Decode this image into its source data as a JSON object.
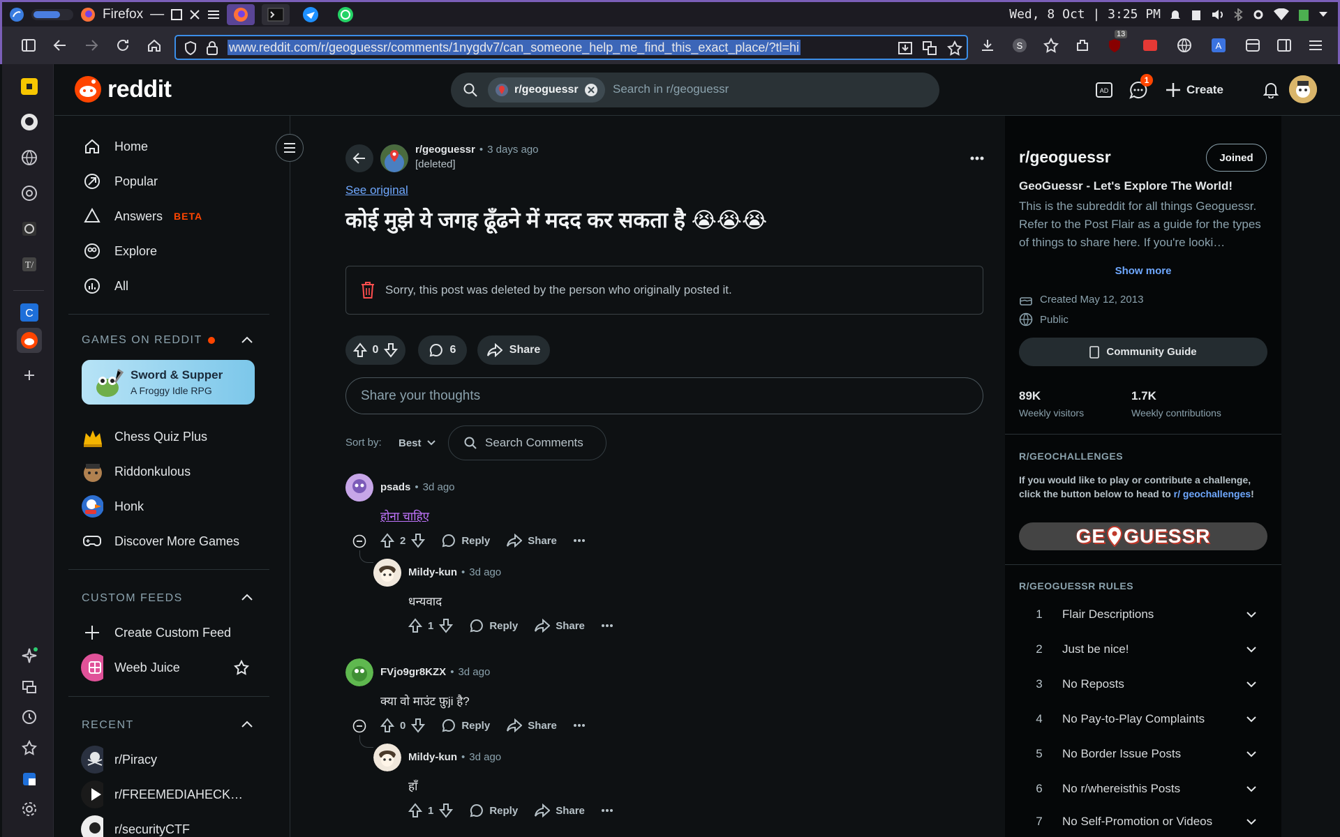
{
  "os_bar": {
    "app_name": "Firefox",
    "datetime": "Wed, 8 Oct | 3:25 PM",
    "colors": {
      "border": "#7b5fb8",
      "active_tab": "#5a4596"
    }
  },
  "browser": {
    "url": "www.reddit.com/r/geoguessr/comments/1nygdv7/can_someone_help_me_find_this_exact_place/?tl=hi",
    "extension_badge": "13"
  },
  "header": {
    "logo_text": "reddit",
    "search_chip": "r/geoguessr",
    "search_placeholder": "Search in r/geoguessr",
    "chat_badge": "1",
    "create_label": "Create"
  },
  "left_nav": {
    "items": [
      {
        "label": "Home",
        "icon": "home-icon"
      },
      {
        "label": "Popular",
        "icon": "popular-icon"
      },
      {
        "label": "Answers",
        "icon": "answers-icon",
        "badge": "BETA"
      },
      {
        "label": "Explore",
        "icon": "explore-icon"
      },
      {
        "label": "All",
        "icon": "all-icon"
      }
    ],
    "games_section": "GAMES ON REDDIT",
    "featured_game": {
      "title": "Sword & Supper",
      "subtitle": "A Froggy Idle RPG"
    },
    "games": [
      "Chess Quiz Plus",
      "Riddonkulous",
      "Honk",
      "Discover More Games"
    ],
    "custom_feeds_section": "CUSTOM FEEDS",
    "custom_feeds": [
      "Create Custom Feed",
      "Weeb Juice"
    ],
    "recent_section": "RECENT",
    "recent": [
      "r/Piracy",
      "r/FREEMEDIAHECK…",
      "r/securityCTF"
    ]
  },
  "post": {
    "subreddit": "r/geoguessr",
    "time": "3 days ago",
    "author": "[deleted]",
    "see_original": "See original",
    "title": "कोई मुझे ये जगह ढूँढने में मदद कर सकता है 😭😭😭",
    "deleted_notice": "Sorry, this post was deleted by the person who originally posted it.",
    "votes": "0",
    "comments": "6",
    "share_label": "Share",
    "comment_placeholder": "Share your thoughts",
    "sort_label": "Sort by:",
    "sort_value": "Best",
    "search_comments": "Search Comments"
  },
  "comments": [
    {
      "author": "psads",
      "time": "3d ago",
      "text": "होना चाहिए",
      "votes": "2"
    },
    {
      "author": "Mildy-kun",
      "time": "3d ago",
      "text": "धन्यवाद",
      "votes": "1"
    },
    {
      "author": "FVjo9gr8KZX",
      "time": "3d ago",
      "text": "क्या वो माउंट फ़ुji है?",
      "votes": "0"
    },
    {
      "author": "Mildy-kun",
      "time": "3d ago",
      "text": "हाँ",
      "votes": "1"
    }
  ],
  "comment_actions": {
    "reply": "Reply",
    "share": "Share",
    "dot": "•"
  },
  "right_sidebar": {
    "name": "r/geoguessr",
    "joined_label": "Joined",
    "tagline": "GeoGuessr - Let's Explore The World!",
    "description": "This is the subreddit for all things Geoguessr. Refer to the Post Flair as a guide for the types of things to share here. If you're looki…",
    "show_more": "Show more",
    "created": "Created May 12, 2013",
    "visibility": "Public",
    "guide_label": "Community Guide",
    "stats": [
      {
        "value": "89K",
        "label": "Weekly visitors"
      },
      {
        "value": "1.7K",
        "label": "Weekly contributions"
      }
    ],
    "challenges_title": "R/GEOCHALLENGES",
    "challenges_text": "If you would like to play or contribute a challenge, click the button below to head to",
    "challenges_link": "r/ geochallenges",
    "challenges_end": "!",
    "banner_text": "GE",
    "banner_text2": "GUESSR",
    "rules_title": "R/GEOGUESSR RULES",
    "rules": [
      {
        "n": "1",
        "t": "Flair Descriptions"
      },
      {
        "n": "2",
        "t": "Just be nice!"
      },
      {
        "n": "3",
        "t": "No Reposts"
      },
      {
        "n": "4",
        "t": "No Pay-to-Play Complaints"
      },
      {
        "n": "5",
        "t": "No Border Issue Posts"
      },
      {
        "n": "6",
        "t": "No r/whereisthis Posts"
      },
      {
        "n": "7",
        "t": "No Self-Promotion or Videos"
      }
    ]
  },
  "colors": {
    "accent_orange": "#ff4500",
    "link_blue": "#6fa8ff",
    "bg": "#0e1113"
  }
}
